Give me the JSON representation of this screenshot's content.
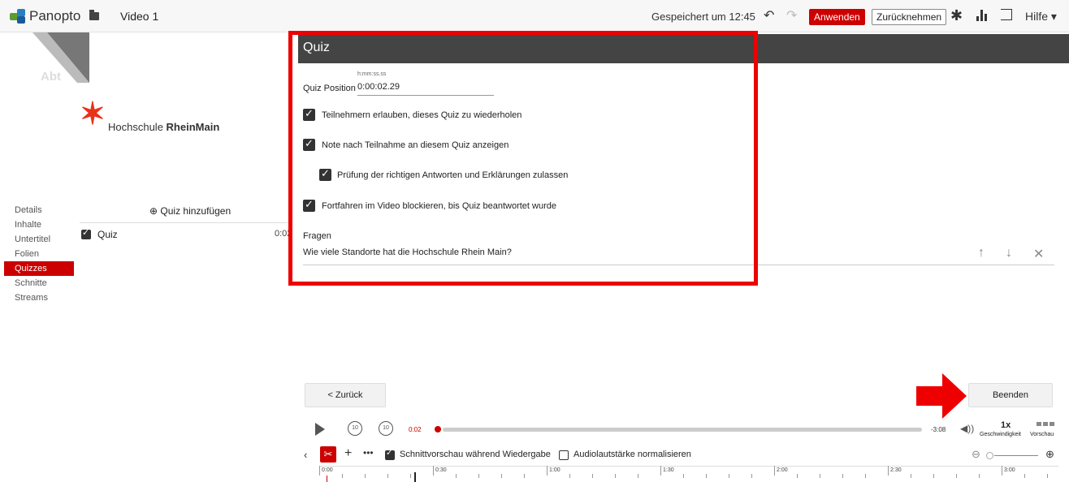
{
  "topbar": {
    "logo": "Panopto",
    "video_title": "Video 1",
    "saved_status": "Gespeichert um 12:45",
    "apply_label": "Anwenden",
    "revert_label": "Zurücknehmen",
    "help_label": "Hilfe ▾"
  },
  "branding": {
    "faded_text": "Abt",
    "org_name_prefix": "Hochschule ",
    "org_name_bold": "RheinMain"
  },
  "sidebar": {
    "items": [
      {
        "label": "Details"
      },
      {
        "label": "Inhalte"
      },
      {
        "label": "Untertitel"
      },
      {
        "label": "Folien"
      },
      {
        "label": "Quizzes",
        "active": true
      },
      {
        "label": "Schnitte"
      },
      {
        "label": "Streams"
      }
    ]
  },
  "quiz_list": {
    "add_label": "⊕ Quiz hinzufügen",
    "items": [
      {
        "label": "Quiz",
        "time": "0:02"
      }
    ]
  },
  "quiz": {
    "title": "Quiz",
    "time_format": "h:mm:ss.ss",
    "position_label": "Quiz Position",
    "position_value": "0:00:02.29",
    "options": [
      {
        "label": "Teilnehmern erlauben, dieses Quiz zu wiederholen",
        "checked": true
      },
      {
        "label": "Note nach Teilnahme an diesem Quiz anzeigen",
        "checked": true
      },
      {
        "label": "Prüfung der richtigen Antworten und Erklärungen zulassen",
        "checked": true
      },
      {
        "label": "Fortfahren im Video blockieren, bis Quiz beantwortet wurde",
        "checked": true
      }
    ],
    "questions_label": "Fragen",
    "questions": [
      {
        "text": "Wie viele Standorte hat die Hochschule Rhein Main?"
      }
    ]
  },
  "buttons": {
    "back_label": "<  Zurück",
    "finish_label": "Beenden"
  },
  "player": {
    "current_time": "0:02",
    "remaining_time": "-3:08",
    "speed": "1x",
    "speed_label": "Geschwindigkeit",
    "preview_label": "Vorschau",
    "skip_back": "10",
    "skip_forward": "10"
  },
  "editor": {
    "cut_preview_label": "Schnittvorschau während Wiedergabe",
    "cut_preview_checked": true,
    "normalize_label": "Audiolautstärke normalisieren",
    "normalize_checked": false
  },
  "timeline": {
    "labels": [
      "0:00",
      "0:30",
      "1:00",
      "1:30",
      "2:00",
      "2:30",
      "3:00"
    ]
  },
  "colors": {
    "accent": "#cc0000",
    "header": "#444444",
    "highlight_frame": "#ee0000"
  }
}
